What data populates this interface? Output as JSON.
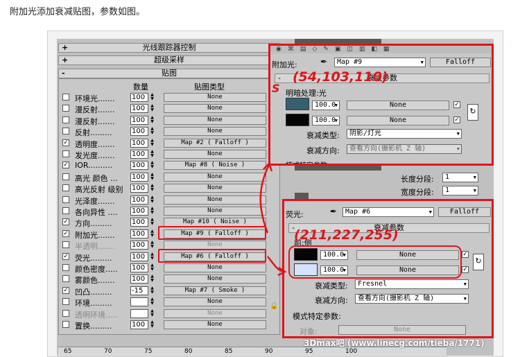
{
  "caption": "附加光添加衰减贴图，参数如图。",
  "rollouts": [
    {
      "sign": "+",
      "title": "光线跟踪器控制"
    },
    {
      "sign": "+",
      "title": "超级采样"
    },
    {
      "sign": "-",
      "title": "贴图"
    }
  ],
  "maps_header": {
    "amount": "数量",
    "map_type": "贴图类型"
  },
  "map_rows": [
    {
      "label": "环境光.......",
      "checked": false,
      "amount": "100",
      "map": "None"
    },
    {
      "label": "漫反射.......",
      "checked": false,
      "amount": "100",
      "map": "None"
    },
    {
      "label": "漫反射.......",
      "checked": false,
      "amount": "100",
      "map": "None"
    },
    {
      "label": "反射.........",
      "checked": false,
      "amount": "100",
      "map": "None"
    },
    {
      "label": "透明度.......",
      "checked": true,
      "amount": "100",
      "map": "Map #2  ( Falloff )"
    },
    {
      "label": "发光度.......",
      "checked": false,
      "amount": "100",
      "map": "None"
    },
    {
      "label": "IOR..........",
      "checked": true,
      "amount": "100",
      "map": "Map #8  ( Noise )"
    },
    {
      "label": "高光 颜色 ...",
      "checked": false,
      "amount": "100",
      "map": "None"
    },
    {
      "label": "高光反射 级别",
      "checked": false,
      "amount": "100",
      "map": "None"
    },
    {
      "label": "光泽度.......",
      "checked": false,
      "amount": "100",
      "map": "None"
    },
    {
      "label": "各向异性 ....",
      "checked": false,
      "amount": "100",
      "map": "None"
    },
    {
      "label": "方向.........",
      "checked": true,
      "amount": "100",
      "map": "Map #10  ( Noise )"
    },
    {
      "label": "附加光.......",
      "checked": true,
      "amount": "100",
      "map": "Map #9  ( Falloff )"
    },
    {
      "label": "半透明.......",
      "checked": false,
      "amount": "100",
      "map": "None",
      "dim": true
    },
    {
      "label": "荧光.........",
      "checked": true,
      "amount": "100",
      "map": "Map #6  ( Falloff )"
    },
    {
      "label": "颜色密度.....",
      "checked": false,
      "amount": "100",
      "map": "None"
    },
    {
      "label": "雾颜色.......",
      "checked": false,
      "amount": "100",
      "map": "None"
    },
    {
      "label": "凹凸.........",
      "checked": true,
      "amount": "-15",
      "map": "Map #7  ( Smoke )"
    },
    {
      "label": "环境.........",
      "checked": false,
      "amount": "",
      "map": "None"
    },
    {
      "label": "透明环境.....",
      "checked": false,
      "amount": "",
      "map": "None",
      "dim": true
    },
    {
      "label": "置换.........",
      "checked": false,
      "amount": "100",
      "map": "None"
    }
  ],
  "popup_top": {
    "slot_label": "附加光:",
    "map_name": "Map #9",
    "map_type": "Falloff",
    "section_title": "衰减参数",
    "group_label": "明暗处理:光",
    "row1_amount": "100.0",
    "row1_map": "None",
    "row2_amount": "100.0",
    "row2_map": "None",
    "falloff_type_label": "衰减类型:",
    "falloff_type": "阴影/灯光",
    "falloff_dir_label": "衰减方向:",
    "falloff_dir": "查看方向(摄影机 Z 轴)",
    "cut_text": "模式特定参数",
    "color1": "#36606e",
    "color2": "#050505",
    "annotation": "(54,103,110)"
  },
  "popup_bottom": {
    "slot_label": "荧光:",
    "map_name": "Map #6",
    "map_type": "Falloff",
    "section_title": "衰减参数",
    "group_label": "前:侧",
    "row1_amount": "100.0",
    "row1_map": "None",
    "row2_amount": "100.0",
    "row2_map": "None",
    "falloff_type_label": "衰减类型:",
    "falloff_type": "Fresnel",
    "falloff_dir_label": "衰减方向:",
    "falloff_dir": "查看方向(摄影机 Z 轴)",
    "mode_title": "模式特定参数:",
    "object_label": "对象:",
    "object_value": "None",
    "color1": "#050505",
    "color2": "#d3e3ff",
    "annotation": "(211,227,255)"
  },
  "segments": {
    "length_label": "长度分段:",
    "length_value": "1",
    "width_label": "宽度分段:",
    "width_value": "1"
  },
  "ruler_ticks": [
    "65",
    "70",
    "75",
    "80",
    "85",
    "90",
    "95",
    "100"
  ],
  "watermark": "3Dmax吧  (www.linecg.com/tieba/1771)"
}
